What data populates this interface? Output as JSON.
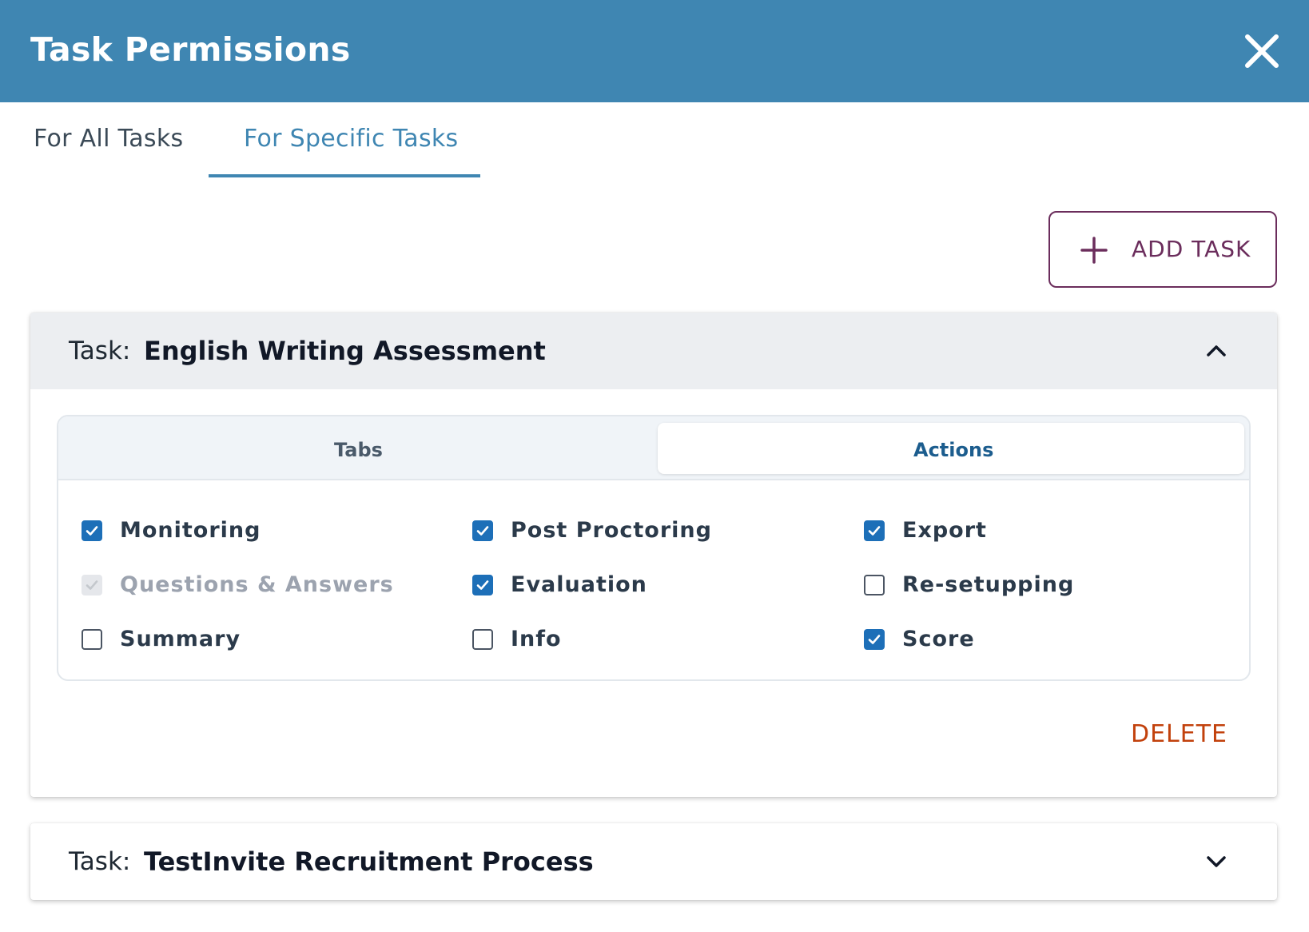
{
  "dialog": {
    "title": "Task Permissions"
  },
  "tabs": [
    {
      "label": "For All Tasks"
    },
    {
      "label": "For Specific Tasks"
    }
  ],
  "add_task_label": "ADD TASK",
  "task_prefix": "Task:",
  "tasks": [
    {
      "name": "English Writing Assessment",
      "expanded": true,
      "segments": [
        {
          "label": "Tabs"
        },
        {
          "label": "Actions"
        }
      ],
      "permissions": [
        {
          "label": "Monitoring",
          "checked": true,
          "disabled": false
        },
        {
          "label": "Post Proctoring",
          "checked": true,
          "disabled": false
        },
        {
          "label": "Export",
          "checked": true,
          "disabled": false
        },
        {
          "label": "Questions & Answers",
          "checked": true,
          "disabled": true
        },
        {
          "label": "Evaluation",
          "checked": true,
          "disabled": false
        },
        {
          "label": "Re-setupping",
          "checked": false,
          "disabled": false
        },
        {
          "label": "Summary",
          "checked": false,
          "disabled": false
        },
        {
          "label": "Info",
          "checked": false,
          "disabled": false
        },
        {
          "label": "Score",
          "checked": true,
          "disabled": false
        }
      ],
      "delete_label": "DELETE"
    },
    {
      "name": "TestInvite Recruitment Process",
      "expanded": false
    }
  ],
  "colors": {
    "header": "#3f86b2",
    "accent": "#3f86b2",
    "checkbox": "#1d6fb8",
    "delete": "#c2410c",
    "add_button": "#6b2d5c"
  }
}
